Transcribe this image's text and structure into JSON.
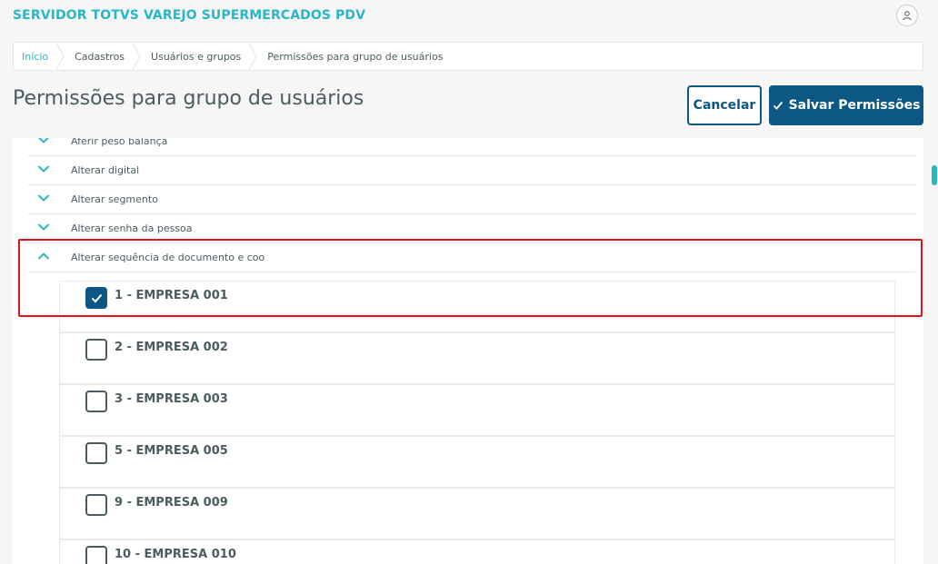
{
  "header": {
    "app_title": "SERVIDOR TOTVS VAREJO SUPERMERCADOS PDV",
    "user_icon": "user-icon"
  },
  "breadcrumb": [
    {
      "label": "Início"
    },
    {
      "label": "Cadastros"
    },
    {
      "label": "Usuários e grupos"
    },
    {
      "label": "Permissões para grupo de usuários"
    }
  ],
  "page": {
    "title": "Permissões para grupo de usuários",
    "cancel_label": "Cancelar",
    "save_label": "Salvar Permissões"
  },
  "permissions": [
    {
      "label": "Aferir peso balança",
      "state": "collapsed"
    },
    {
      "label": "Alterar digital",
      "state": "collapsed"
    },
    {
      "label": "Alterar segmento",
      "state": "collapsed"
    },
    {
      "label": "Alterar senha da pessoa",
      "state": "collapsed"
    },
    {
      "label": "Alterar sequência de documento e coo",
      "state": "expanded"
    }
  ],
  "companies": [
    {
      "label": "1 - EMPRESA 001",
      "checked": true
    },
    {
      "label": "2 - EMPRESA 002",
      "checked": false
    },
    {
      "label": "3 - EMPRESA 003",
      "checked": false
    },
    {
      "label": "5 - EMPRESA 005",
      "checked": false
    },
    {
      "label": "9 - EMPRESA 009",
      "checked": false
    },
    {
      "label": "10 - EMPRESA 010",
      "checked": false
    }
  ],
  "colors": {
    "accent": "#29b6c5",
    "primary": "#0c5784",
    "highlight": "#e0141c"
  }
}
